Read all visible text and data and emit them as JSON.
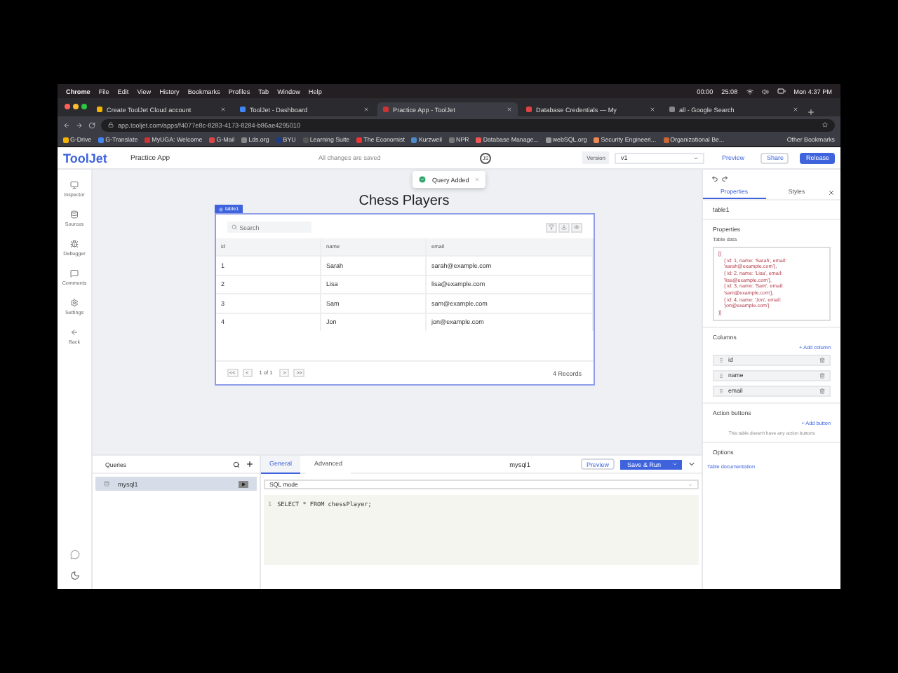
{
  "menubar": {
    "app": "Chrome",
    "items": [
      "File",
      "Edit",
      "View",
      "History",
      "Bookmarks",
      "Profiles",
      "Tab",
      "Window",
      "Help"
    ],
    "status": [
      "00:00",
      "25:08"
    ],
    "clock": "Mon 4:37 PM"
  },
  "browser_tabs": [
    {
      "title": "Create ToolJet Cloud account",
      "selected": false
    },
    {
      "title": "ToolJet - Dashboard",
      "selected": false
    },
    {
      "title": "Practice App - ToolJet",
      "selected": true
    },
    {
      "title": "Database Credentials — My",
      "selected": false
    },
    {
      "title": "all - Google Search",
      "selected": false
    }
  ],
  "address": "app.tooljet.com/apps/f4077e8c-8283-4173-8284-b86ae4295010",
  "bookmarks": [
    "G-Drive",
    "G-Translate",
    "MyUGA: Welcome",
    "G-Mail",
    "Lds.org",
    "BYU",
    "Learning Suite",
    "The Economist",
    "Kurzweil",
    "NPR",
    "Database Manage...",
    "webSQL.org",
    "Security Engineeri...",
    "Organizational Be..."
  ],
  "other_bookmarks": "Other Bookmarks",
  "app_header": {
    "logo": "ToolJet",
    "app_name": "Practice App",
    "save_status": "All changes are saved",
    "avatar": "JS",
    "version_label": "Version",
    "version": "v1",
    "buttons": [
      "Preview",
      "Share",
      "Release"
    ]
  },
  "sidebar": {
    "items": [
      "Inspector",
      "Sources",
      "Debugger",
      "Comments",
      "Settings",
      "Back"
    ]
  },
  "toast": {
    "message": "Query Added"
  },
  "canvas": {
    "title": "Chess Players",
    "widget_tag": "table1",
    "search_placeholder": "Search",
    "columns": [
      "id",
      "name",
      "email"
    ],
    "rows": [
      [
        "1",
        "Sarah",
        "sarah@example.com"
      ],
      [
        "2",
        "Lisa",
        "lisa@example.com"
      ],
      [
        "3",
        "Sam",
        "sam@example.com"
      ],
      [
        "4",
        "Jon",
        "jon@example.com"
      ]
    ],
    "pagination": [
      "<<",
      "<",
      "1 of 1",
      ">",
      ">>"
    ],
    "records": "4 Records"
  },
  "inspector": {
    "tabs": [
      {
        "label": "Properties",
        "selected": true
      },
      {
        "label": "Styles",
        "selected": false
      }
    ],
    "component": "table1",
    "properties_title": "Properties",
    "table_data_label": "Table data",
    "table_data": [
      "[{",
      "{ id: 1, name: 'Sarah', email: 'sarah@example.com'},",
      "{ id: 2, name: 'Lisa', email: 'lisa@example.com'},",
      "{ id: 3, name: 'Sam', email: 'sam@example.com'},",
      "{ id: 4, name: 'Jon', email: 'jon@example.com'}",
      "}]"
    ],
    "columns_title": "Columns",
    "add_column": "+ Add column",
    "column_items": [
      "id",
      "name",
      "email"
    ],
    "action_buttons_title": "Action buttons",
    "add_button": "+ Add button",
    "empty_actions": "This table doesn't have any action buttons",
    "options_title": "Options",
    "docs_link": "Table documentation"
  },
  "queries": {
    "title": "Queries",
    "items": [
      {
        "name": "mysql1",
        "selected": true
      }
    ]
  },
  "query_editor": {
    "tabs": [
      {
        "label": "General",
        "selected": true
      },
      {
        "label": "Advanced",
        "selected": false
      }
    ],
    "name": "mysql1",
    "preview": "Preview",
    "run": "Save & Run",
    "mode": "SQL mode",
    "code": [
      {
        "line": "1",
        "text": "SELECT * FROM chessPlayer;"
      }
    ]
  }
}
